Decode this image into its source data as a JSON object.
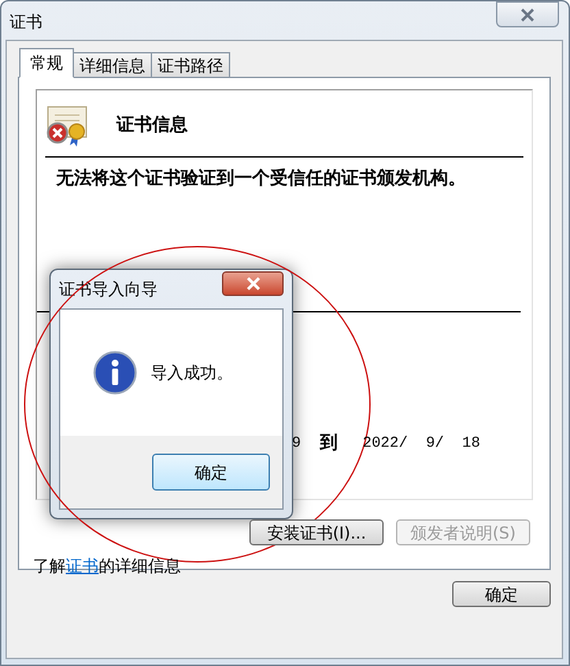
{
  "window": {
    "title": "证书",
    "tabs": [
      {
        "label": "常规",
        "selected": true
      },
      {
        "label": "详细信息",
        "selected": false
      },
      {
        "label": "证书路径",
        "selected": false
      }
    ],
    "info_title": "证书信息",
    "warning": "无法将这个证书验证到一个受信任的证书颁发机构。",
    "validity": {
      "from_tail": "9",
      "to_label": "到",
      "to_date": "2022/  9/  18"
    },
    "buttons": [
      {
        "label": "安装证书(I)...",
        "disabled": false
      },
      {
        "label": "颁发者说明(S)",
        "disabled": true
      }
    ],
    "learn_more": {
      "before": "了解",
      "link": "证书",
      "after": "的详细信息"
    },
    "ok_button": "确定"
  },
  "dialog": {
    "title": "证书导入向导",
    "message": "导入成功。",
    "ok_button": "确定"
  }
}
